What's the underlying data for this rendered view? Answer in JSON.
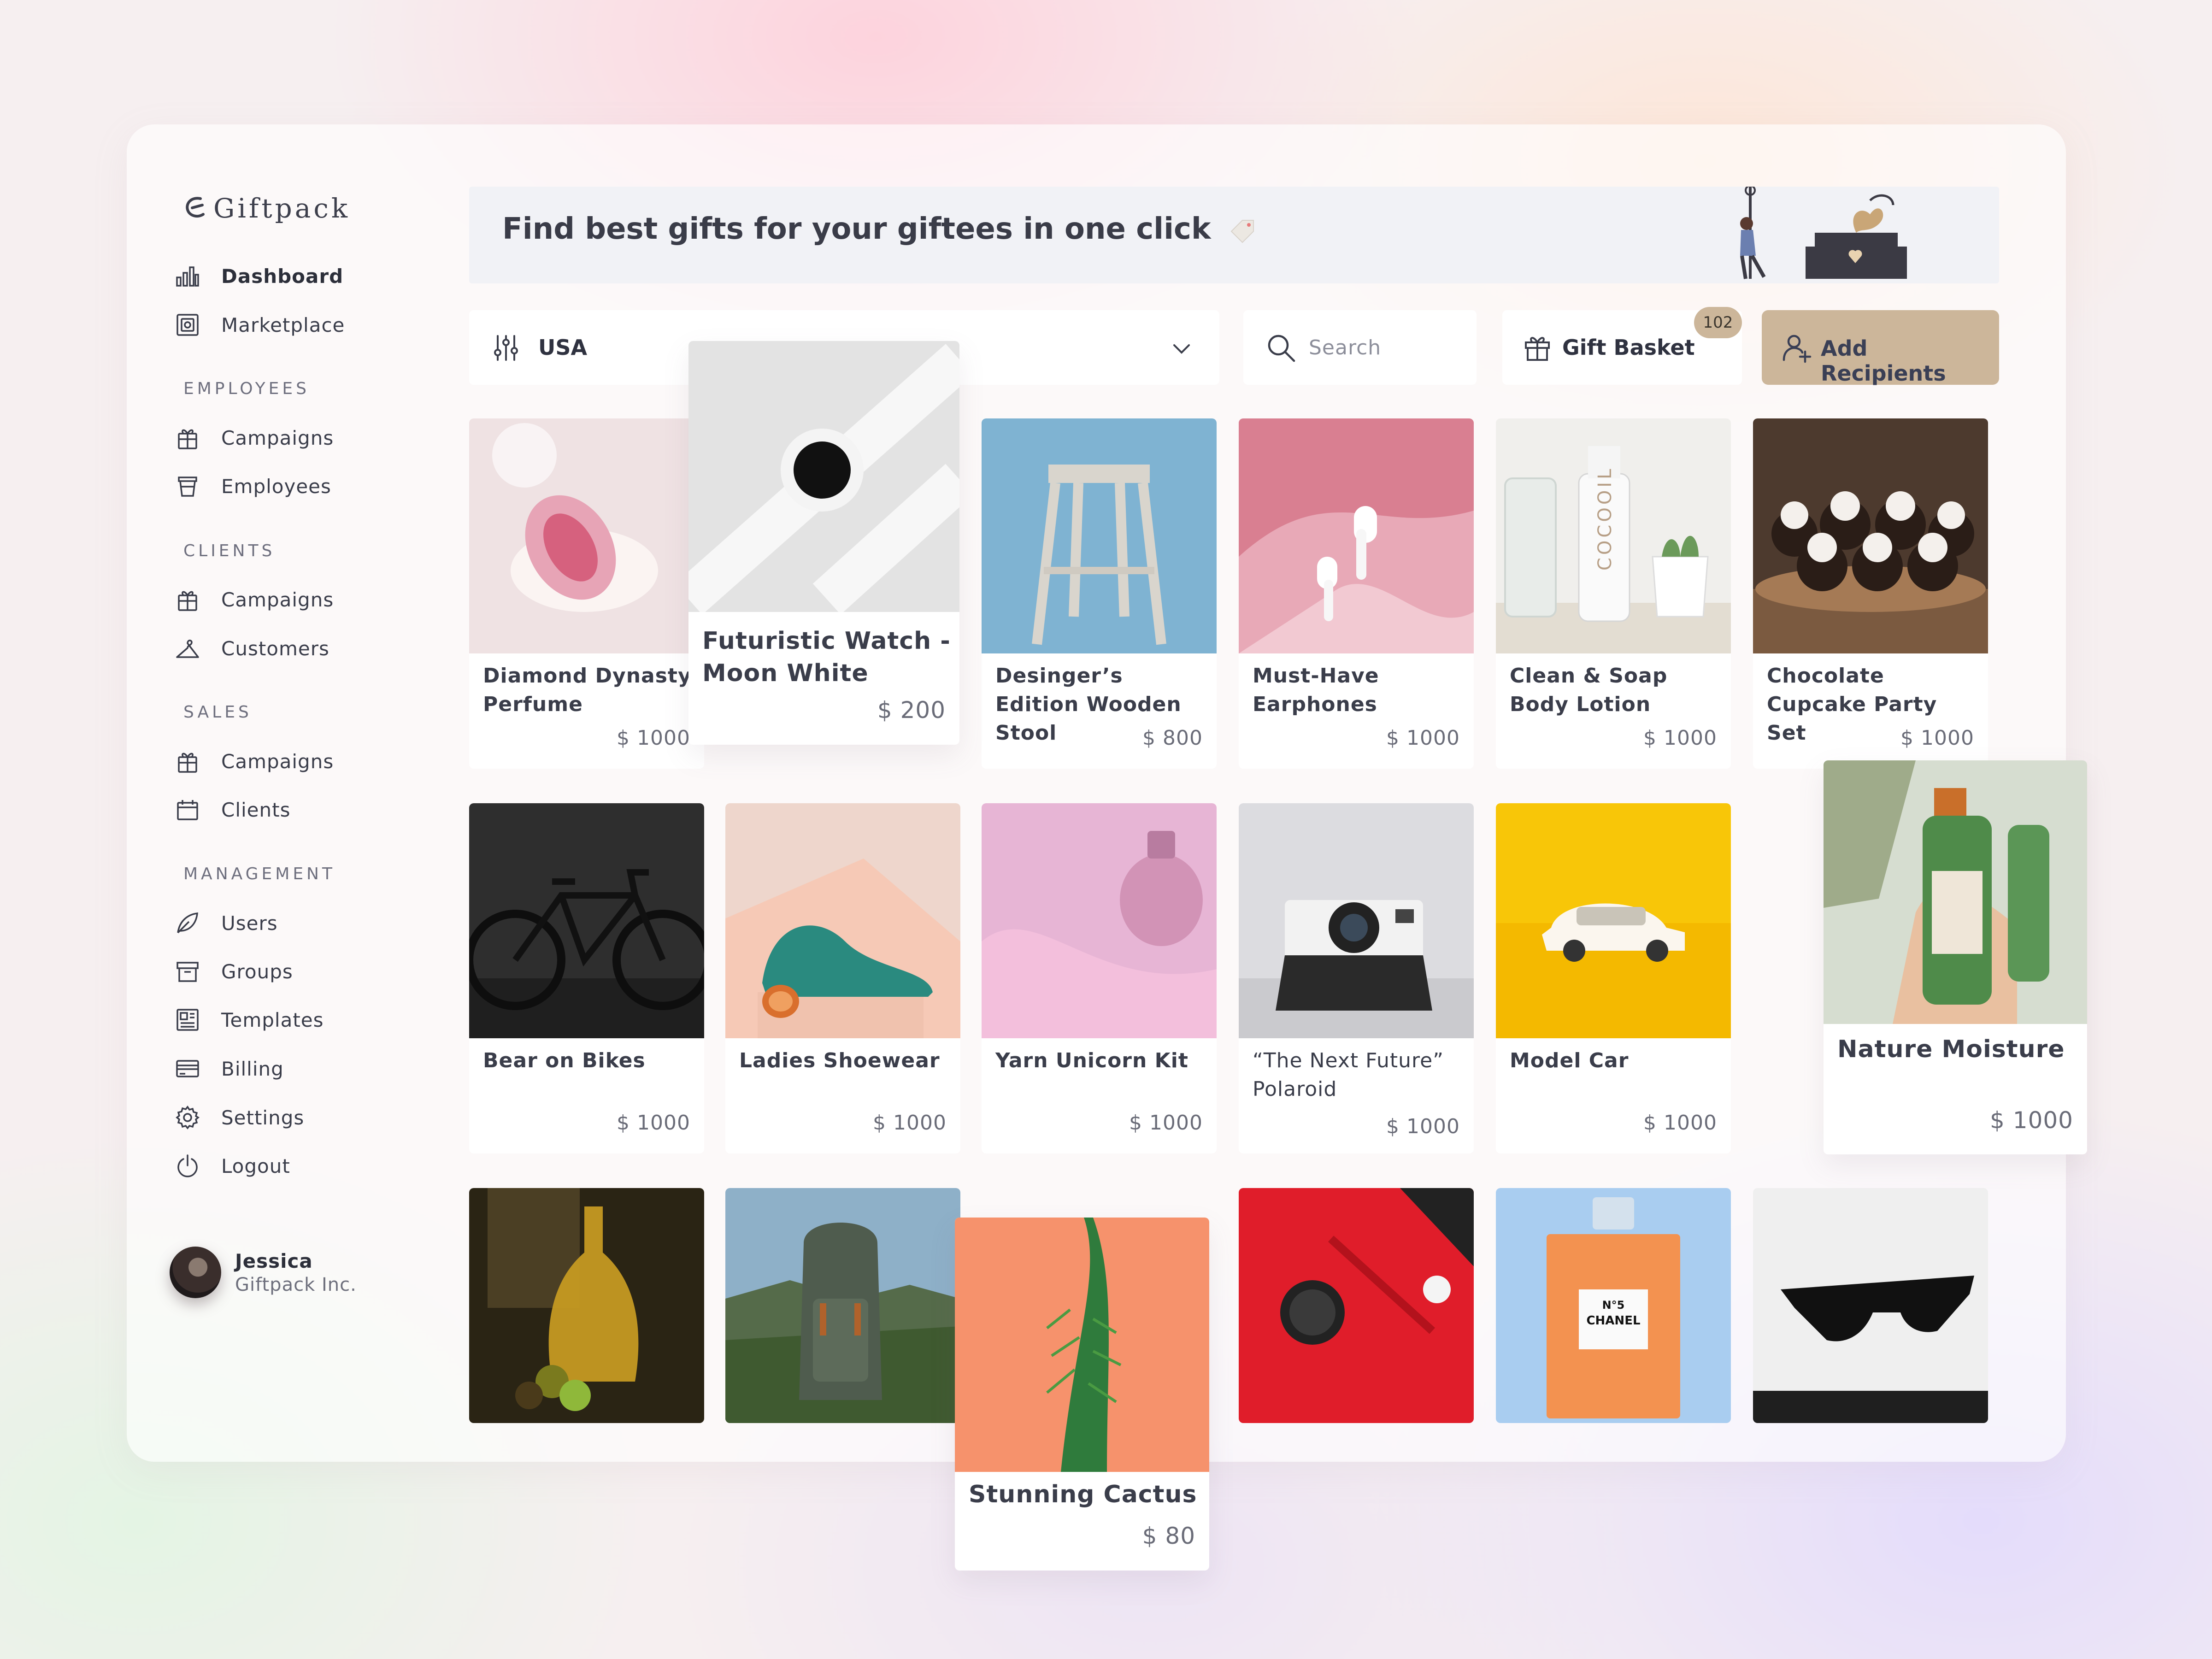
{
  "app": {
    "name": "Giftpack"
  },
  "sidebar": {
    "top_items": [
      {
        "label": "Dashboard",
        "icon": "bar-chart-icon"
      },
      {
        "label": "Marketplace",
        "icon": "marketplace-icon"
      }
    ],
    "sections": [
      {
        "title": "EMPLOYEES",
        "items": [
          {
            "label": "Campaigns",
            "icon": "gift-box-icon"
          },
          {
            "label": "Employees",
            "icon": "cup-icon"
          }
        ]
      },
      {
        "title": "CLIENTS",
        "items": [
          {
            "label": "Campaigns",
            "icon": "gift-box-icon"
          },
          {
            "label": "Customers",
            "icon": "hanger-icon"
          }
        ]
      },
      {
        "title": "SALES",
        "items": [
          {
            "label": "Campaigns",
            "icon": "gift-box-icon"
          },
          {
            "label": "Clients",
            "icon": "calendar-box-icon"
          }
        ]
      },
      {
        "title": "MANAGEMENT",
        "items": [
          {
            "label": "Users",
            "icon": "leaf-icon"
          },
          {
            "label": "Groups",
            "icon": "archive-icon"
          },
          {
            "label": "Templates",
            "icon": "template-icon"
          },
          {
            "label": "Billing",
            "icon": "card-icon"
          },
          {
            "label": "Settings",
            "icon": "gear-icon"
          },
          {
            "label": "Logout",
            "icon": "power-icon"
          }
        ]
      }
    ]
  },
  "user": {
    "name": "Jessica",
    "company": "Giftpack Inc."
  },
  "banner": {
    "title": "Find best gifts for your giftees in one click"
  },
  "filters": {
    "country": "USA",
    "search_placeholder": "Search",
    "gift_basket_label": "Gift Basket",
    "gift_basket_count": "102",
    "add_recipients_label": "Add Recipients"
  },
  "products": [
    {
      "name": "Diamond Dynasty Perfume",
      "price": "$ 1000",
      "colors": [
        "#f4e6e8",
        "#d8a0ad"
      ]
    },
    {
      "name": "Futuristic Watch - Moon White",
      "price": "$ 200",
      "colors": [
        "#e6e6e6",
        "#cfcfcf"
      ]
    },
    {
      "name": "Desinger’s Edition Wooden Stool",
      "price": "$ 800",
      "colors": [
        "#86b7d3",
        "#6ea5c6"
      ]
    },
    {
      "name": "Must-Have Earphones",
      "price": "$ 1000",
      "colors": [
        "#e9a7b5",
        "#c5626f"
      ]
    },
    {
      "name": "Clean & Soap Body Lotion",
      "price": "$ 1000",
      "colors": [
        "#ecebe8",
        "#d9d5cd"
      ]
    },
    {
      "name": "Chocolate Cupcake Party Set",
      "price": "$ 1000",
      "colors": [
        "#6b5546",
        "#2f231d"
      ]
    },
    {
      "name": "Bear on Bikes",
      "price": "$ 1000",
      "colors": [
        "#3a3a3a",
        "#1c1c1c"
      ]
    },
    {
      "name": "Ladies Shoewear",
      "price": "$ 1000",
      "colors": [
        "#efd4cb",
        "#dcb8aa"
      ]
    },
    {
      "name": "Yarn Unicorn Kit",
      "price": "$ 1000",
      "colors": [
        "#e8b7d7",
        "#d59ac3"
      ]
    },
    {
      "name": "“The Next Future” Polaroid",
      "price": "$ 1000",
      "colors": [
        "#d8d8dc",
        "#c7c7cc"
      ]
    },
    {
      "name": "Model Car",
      "price": "$ 1000",
      "colors": [
        "#f8c70a",
        "#f2b600"
      ]
    },
    {
      "name": "Nature Moisture",
      "price": "$ 1000",
      "colors": [
        "#c9d2c0",
        "#4f8b4a"
      ]
    },
    {
      "name": "",
      "price": "",
      "colors": [
        "#5d4a24",
        "#2a2414"
      ]
    },
    {
      "name": "",
      "price": "",
      "colors": [
        "#6b8aa6",
        "#3f5a3c"
      ]
    },
    {
      "name": "Stunning Cactus",
      "price": "$ 80",
      "colors": [
        "#f6946e",
        "#f07f58"
      ]
    },
    {
      "name": "",
      "price": "",
      "colors": [
        "#e01d2a",
        "#b3121c"
      ]
    },
    {
      "name": "",
      "price": "",
      "colors": [
        "#9cc6ee",
        "#f08a3a"
      ]
    },
    {
      "name": "",
      "price": "",
      "colors": [
        "#f2f2f2",
        "#dcdcdc"
      ]
    }
  ]
}
